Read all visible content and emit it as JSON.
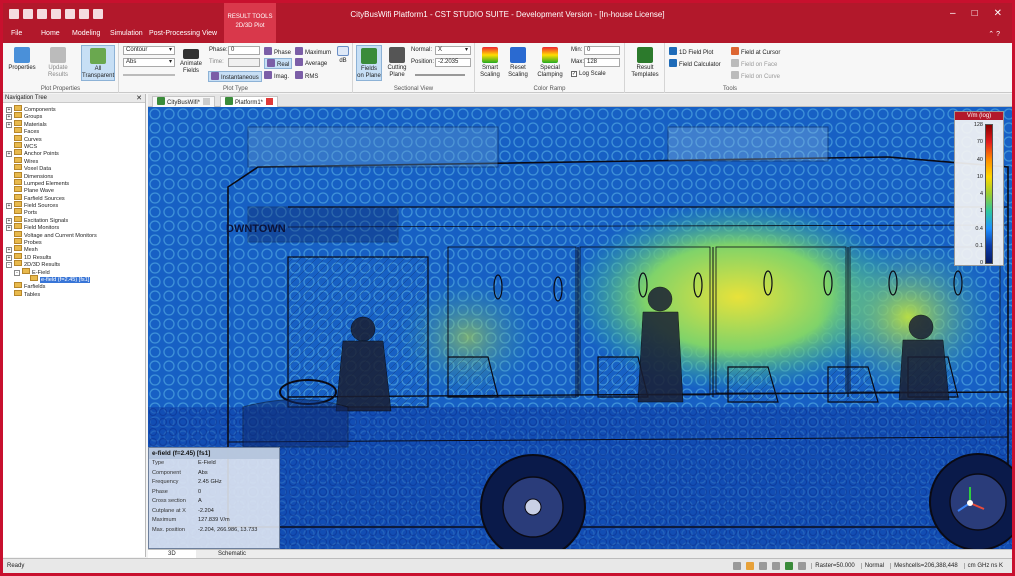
{
  "window": {
    "title": "CityBusWifi Platform1 - CST STUDIO SUITE - Development Version - [In-house License]",
    "context_tab_group": "RESULT TOOLS",
    "context_tab": "2D/3D Plot"
  },
  "ribbon_tabs": [
    "File",
    "Home",
    "Modeling",
    "Simulation",
    "Post-Processing",
    "View"
  ],
  "ribbon": {
    "plot_properties": {
      "label": "Plot Properties",
      "properties": "Properties",
      "update_results": "Update Results",
      "all_transparent": "All Transparent"
    },
    "plot_type": {
      "label": "Plot Type",
      "style_value": "Contour",
      "component_value": "Abs",
      "animate_fields": "Animate Fields",
      "phase_label": "Phase:",
      "phase_value": "0",
      "time_label": "Time:",
      "instantaneous": "Instantaneous",
      "phase_btn": "Phase",
      "real_btn": "Real",
      "imag_btn": "Imag.",
      "maximum_btn": "Maximum",
      "average_btn": "Average",
      "rms_btn": "RMS",
      "db_btn": "dB"
    },
    "sectional_view": {
      "label": "Sectional View",
      "fields_on_plane": "Fields on Plane",
      "cutting_plane": "Cutting Plane",
      "normal_label": "Normal:",
      "normal_value": "X",
      "position_label": "Position:",
      "position_value": "-2.2035"
    },
    "color_ramp": {
      "label": "Color Ramp",
      "smart_scaling": "Smart Scaling",
      "reset_scaling": "Reset Scaling",
      "special_clamping": "Special Clamping",
      "min_label": "Min:",
      "min_value": "0",
      "max_label": "Max:",
      "max_value": "128",
      "log_scale": "Log Scale"
    },
    "result_templates": "Result Templates",
    "tools": {
      "label": "Tools",
      "field_plot_1d": "1D Field Plot",
      "field_calculator": "Field Calculator",
      "field_at_cursor": "Field at Cursor",
      "field_on_face": "Field on Face",
      "field_on_curve": "Field on Curve"
    }
  },
  "nav_tree": {
    "title": "Navigation Tree",
    "items": [
      {
        "label": "Components",
        "expand": "+",
        "depth": 0
      },
      {
        "label": "Groups",
        "expand": "+",
        "depth": 0
      },
      {
        "label": "Materials",
        "expand": "+",
        "depth": 0
      },
      {
        "label": "Faces",
        "expand": "",
        "depth": 0
      },
      {
        "label": "Curves",
        "expand": "",
        "depth": 0
      },
      {
        "label": "WCS",
        "expand": "",
        "depth": 0
      },
      {
        "label": "Anchor Points",
        "expand": "+",
        "depth": 0
      },
      {
        "label": "Wires",
        "expand": "",
        "depth": 0
      },
      {
        "label": "Voxel Data",
        "expand": "",
        "depth": 0
      },
      {
        "label": "Dimensions",
        "expand": "",
        "depth": 0
      },
      {
        "label": "Lumped Elements",
        "expand": "",
        "depth": 0
      },
      {
        "label": "Plane Wave",
        "expand": "",
        "depth": 0
      },
      {
        "label": "Farfield Sources",
        "expand": "",
        "depth": 0
      },
      {
        "label": "Field Sources",
        "expand": "+",
        "depth": 0
      },
      {
        "label": "Ports",
        "expand": "",
        "depth": 0
      },
      {
        "label": "Excitation Signals",
        "expand": "+",
        "depth": 0
      },
      {
        "label": "Field Monitors",
        "expand": "+",
        "depth": 0
      },
      {
        "label": "Voltage and Current Monitors",
        "expand": "",
        "depth": 0
      },
      {
        "label": "Probes",
        "expand": "",
        "depth": 0
      },
      {
        "label": "Mesh",
        "expand": "+",
        "depth": 0
      },
      {
        "label": "1D Results",
        "expand": "+",
        "depth": 0
      },
      {
        "label": "2D/3D Results",
        "expand": "-",
        "depth": 0
      },
      {
        "label": "E-Field",
        "expand": "-",
        "depth": 1
      },
      {
        "label": "e-field (f=2.45) [fs1]",
        "expand": "",
        "depth": 2,
        "selected": true
      },
      {
        "label": "Farfields",
        "expand": "",
        "depth": 0
      },
      {
        "label": "Tables",
        "expand": "",
        "depth": 0
      }
    ]
  },
  "doc_tabs": [
    {
      "label": "CityBusWifi*",
      "active": false
    },
    {
      "label": "Platform1*",
      "active": true
    }
  ],
  "legend": {
    "title": "V/m (log)",
    "ticks": [
      "128",
      "70",
      "40",
      "10",
      "4",
      "1",
      "0.4",
      "0.1",
      "0"
    ]
  },
  "scene_text": {
    "bus_sign": "DWNTOWN"
  },
  "info_panel": {
    "title": "e-field (f=2.45) [fs1]",
    "rows": [
      {
        "k": "Type",
        "v": "E-Field"
      },
      {
        "k": "Component",
        "v": "Abs"
      },
      {
        "k": "Frequency",
        "v": "2.45 GHz"
      },
      {
        "k": "Phase",
        "v": "0"
      },
      {
        "k": "Cross section",
        "v": "A"
      },
      {
        "k": "Cutplane at X",
        "v": "-2.204"
      },
      {
        "k": "Maximum",
        "v": "127.839 V/m"
      },
      {
        "k": "Max. position",
        "v": "-2.204, 266.986, 13.733"
      }
    ]
  },
  "bottom_tabs": [
    "3D",
    "Schematic"
  ],
  "status": {
    "ready": "Ready",
    "raster": "Raster=50.000",
    "mode": "Normal",
    "meshcells": "Meshcells=206,388,448",
    "units": "cm GHz ns K"
  },
  "colors": {
    "titlebar": "#b2182b",
    "field_low": "#0a3ca8",
    "field_mid": "#2ec7a0",
    "field_high": "#ffd700"
  }
}
